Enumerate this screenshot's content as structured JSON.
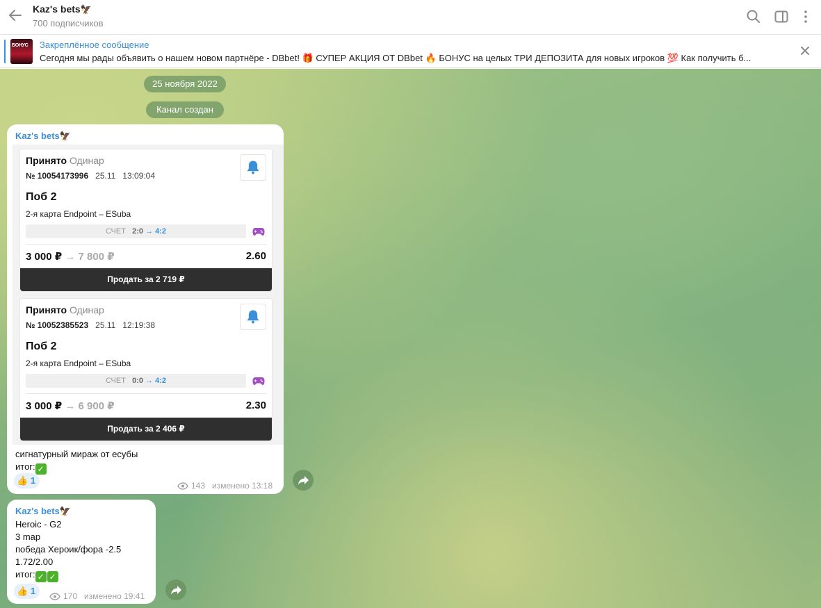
{
  "header": {
    "title": "Kaz's bets",
    "subscribers": "700 подписчиков"
  },
  "pinned": {
    "label": "Закреплённое сообщение",
    "thumb_text": "БОНУС",
    "text": "Сегодня мы рады объявить о нашем новом партнёре - DBbet! 🎁 СУПЕР АКЦИЯ ОТ DBbet 🔥  БОНУС на целых ТРИ ДЕПОЗИТА для новых игроков 💯  Как получить б..."
  },
  "service": {
    "date": "25 ноября 2022",
    "created": "Канал создан"
  },
  "messages": [
    {
      "author": "Kaz's bets",
      "bets": [
        {
          "status": "Принято",
          "type": "Одинар",
          "number": "№ 10054173996",
          "date": "25.11",
          "time": "13:09:04",
          "pick": "Поб 2",
          "event": "2-я карта Endpoint – ESuba",
          "score_label": "СЧЕТ",
          "score_from": "2:0",
          "score_to": "→ 4:2",
          "stake": "3 000 ₽",
          "payout": "7 800 ₽",
          "odds": "2.60",
          "sell": "Продать за 2 719 ₽"
        },
        {
          "status": "Принято",
          "type": "Одинар",
          "number": "№ 10052385523",
          "date": "25.11",
          "time": "12:19:38",
          "pick": "Поб 2",
          "event": "2-я карта Endpoint – ESuba",
          "score_label": "СЧЕТ",
          "score_from": "0:0",
          "score_to": "→ 4:2",
          "stake": "3 000 ₽",
          "payout": "6 900 ₽",
          "odds": "2.30",
          "sell": "Продать за 2 406 ₽"
        }
      ],
      "text_line1": "сигнатурный мираж от есубы",
      "text_line2": "итог:",
      "reaction_emoji": "👍",
      "reaction_count": "1",
      "views": "143",
      "edited": "изменено 13:18"
    },
    {
      "author": "Kaz's bets",
      "lines": [
        "Heroic - G2",
        "3 map",
        "победа Хероик/фора -2.5",
        "1.72/2.00"
      ],
      "result_label": "итог:",
      "reaction_emoji": "👍",
      "reaction_count": "1",
      "views": "170",
      "edited": "изменено 19:41"
    }
  ],
  "colors": {
    "accent": "#3a8fd6",
    "check": "#4cb22c",
    "sell_button": "#2f2f2f"
  }
}
